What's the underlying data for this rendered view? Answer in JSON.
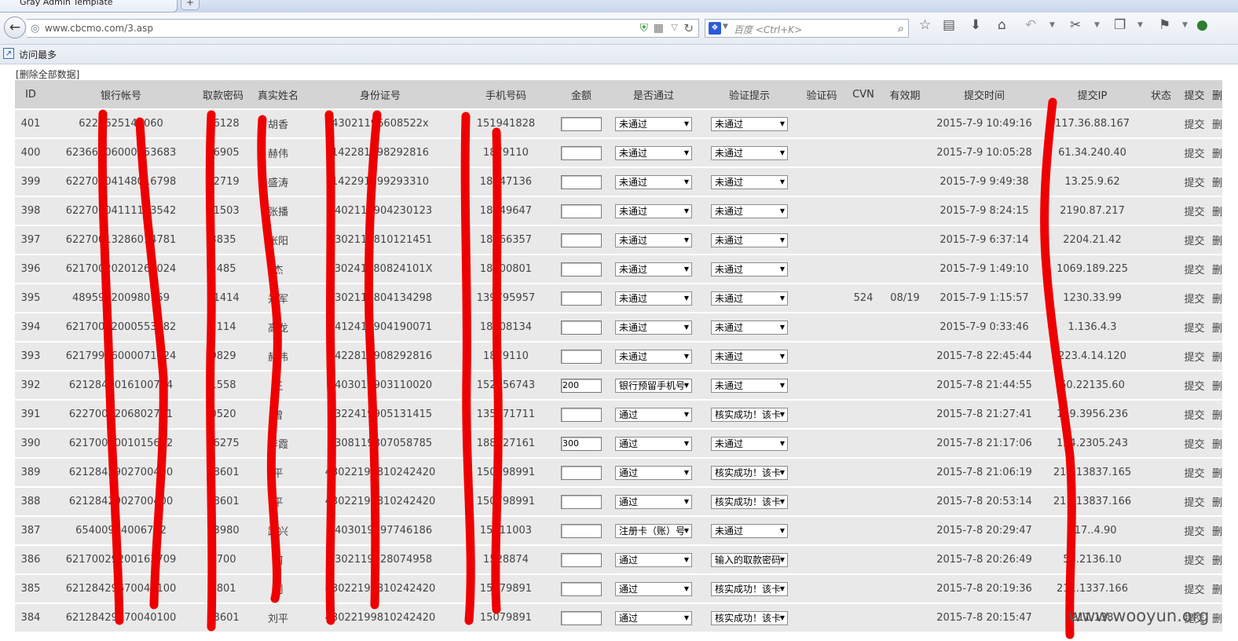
{
  "browser": {
    "tab_title": "Gray Admin Template",
    "new_tab": "+",
    "url": "www.cbcmo.com/3.asp",
    "search_placeholder": "百度 <Ctrl+K>",
    "bookmark_label": "访问最多"
  },
  "page": {
    "clear_all": "[删除全部数据]",
    "watermark": "www.wooyun.org"
  },
  "table": {
    "headers": [
      "ID",
      "银行帐号",
      "取款密码",
      "真实姓名",
      "身份证号",
      "手机号码",
      "金额",
      "是否通过",
      "验证提示",
      "验证码",
      "CVN",
      "有效期",
      "提交时间",
      "提交IP",
      "状态",
      "提交",
      "删除"
    ],
    "submit_label": "提交",
    "delete_label": "删除",
    "rows": [
      {
        "id": "401",
        "account": "62216‌2514‌5060",
        "pwd": "66‌128",
        "name": "胡‌香",
        "idcard": "430‌211966‌08522x",
        "phone": "151‌941828",
        "amount": "",
        "pass": "未通过",
        "hint": "未通过",
        "captcha": "",
        "cvn": "",
        "expiry": "",
        "time": "2015-7-9 10:49:16",
        "ip": "117.‌36.88.167"
      },
      {
        "id": "400",
        "account": "6236680‌60001‌53683",
        "pwd": "96‌905",
        "name": "赫‌伟",
        "idcard": "142‌28199‌8292816",
        "phone": "187‌911‌0",
        "amount": "",
        "pass": "未通过",
        "hint": "未通过",
        "captcha": "",
        "cvn": "",
        "expiry": "",
        "time": "2015-7-9 10:05:28",
        "ip": "61.‌34.240.40"
      },
      {
        "id": "399",
        "account": "62270004‌1480‌16798",
        "pwd": "92‌719",
        "name": "盛‌涛",
        "idcard": "142‌29199‌9293310",
        "phone": "183‌4713‌6",
        "amount": "",
        "pass": "未通过",
        "hint": "未通过",
        "captcha": "",
        "cvn": "",
        "expiry": "",
        "time": "2015-7-9 9:49:38",
        "ip": "1‌3.25.9.62"
      },
      {
        "id": "398",
        "account": "62270004‌1111‌13542",
        "pwd": "21‌503",
        "name": "张‌播",
        "idcard": "140‌21199‌04230123",
        "phone": "188‌4964‌7",
        "amount": "",
        "pass": "未通过",
        "hint": "未通过",
        "captcha": "",
        "cvn": "",
        "expiry": "",
        "time": "2015-7-9 8:24:15",
        "ip": "21‌90.87.217"
      },
      {
        "id": "397",
        "account": "62270013‌2860‌14781",
        "pwd": "38‌35",
        "name": "张‌阳",
        "idcard": "430‌21198‌10121451",
        "phone": "183‌6635‌7",
        "amount": "",
        "pass": "未通过",
        "hint": "未通过",
        "captcha": "",
        "cvn": "",
        "expiry": "",
        "time": "2015-7-9 6:37:14",
        "ip": "22‌04.21.42"
      },
      {
        "id": "396",
        "account": "62170020‌2012‌6‌2024",
        "pwd": "24‌85",
        "name": "‌杰",
        "idcard": "430‌24198‌0824101X",
        "phone": "187‌0080‌1",
        "amount": "",
        "pass": "未通过",
        "hint": "未通过",
        "captcha": "",
        "cvn": "",
        "expiry": "",
        "time": "2015-7-9 1:49:10",
        "ip": "106‌9.189.225"
      },
      {
        "id": "395",
        "account": "489592‌2009801‌59",
        "pwd": "11‌414",
        "name": "郑‌军",
        "idcard": "430‌21198‌04134298",
        "phone": "1397‌9595‌7",
        "amount": "",
        "pass": "未通过",
        "hint": "未通过",
        "captcha": "",
        "cvn": "524",
        "expiry": "08/19",
        "time": "2015-7-9 1:15:57",
        "ip": "12‌30.33.99"
      },
      {
        "id": "394",
        "account": "62170012‌00055‌3182",
        "pwd": "21‌14",
        "name": "高‌龙",
        "idcard": "141‌24199‌04190071",
        "phone": "183‌0813‌4",
        "amount": "",
        "pass": "未通过",
        "hint": "未通过",
        "captcha": "",
        "cvn": "",
        "expiry": "",
        "time": "2015-7-9 0:33:46",
        "ip": "1‌.136.4.3"
      },
      {
        "id": "393",
        "account": "62179916‌00007‌1424",
        "pwd": "98‌29",
        "name": "赫‌伟",
        "idcard": "142‌28199‌08292816",
        "phone": "187‌911‌0",
        "amount": "",
        "pass": "未通过",
        "hint": "未通过",
        "captcha": "",
        "cvn": "",
        "expiry": "",
        "time": "2015-7-8 22:45:44",
        "ip": "223.‌4.14.120"
      },
      {
        "id": "392",
        "account": "62128400‌1610073‌4",
        "pwd": "15‌58",
        "name": "王‌",
        "idcard": "140‌30199‌03110020",
        "phone": "1523‌5674‌3",
        "amount": "200",
        "pass": "银行预留手机号",
        "hint": "未通过",
        "captcha": "",
        "cvn": "",
        "expiry": "",
        "time": "2015-7-8 21:44:55",
        "ip": "60.22‌135.60"
      },
      {
        "id": "391",
        "account": "62270032‌0680278‌1",
        "pwd": "05‌20",
        "name": "曾‌",
        "idcard": "432‌24199‌05131415",
        "phone": "1354‌7171‌1",
        "amount": "",
        "pass": "通过",
        "hint": "核实成功！该卡",
        "captcha": "",
        "cvn": "",
        "expiry": "",
        "time": "2015-7-8 21:27:41",
        "ip": "119.39‌56.236"
      },
      {
        "id": "390",
        "account": "62170030‌0101560‌2",
        "pwd": "66‌275",
        "name": "李‌霞",
        "idcard": "430‌81198‌07058785",
        "phone": "1889‌2716‌1",
        "amount": "300",
        "pass": "通过",
        "hint": "未通过",
        "captcha": "",
        "cvn": "",
        "expiry": "",
        "time": "2015-7-8 21:17:06",
        "ip": "124.230‌5.243"
      },
      {
        "id": "389",
        "account": "62128429‌0270040‌0",
        "pwd": "38‌601",
        "name": "‌平",
        "idcard": "430‌22199‌810242420",
        "phone": "1507‌9899‌1",
        "amount": "",
        "pass": "通过",
        "hint": "核实成功！该卡",
        "captcha": "",
        "cvn": "",
        "expiry": "",
        "time": "2015-7-8 21:06:19",
        "ip": "211.138‌37.165"
      },
      {
        "id": "388",
        "account": "62128429‌0270040‌0",
        "pwd": "38‌601",
        "name": "‌平",
        "idcard": "430‌22199‌810242420",
        "phone": "1507‌9899‌1",
        "amount": "",
        "pass": "通过",
        "hint": "核实成功！该卡",
        "captcha": "",
        "cvn": "",
        "expiry": "",
        "time": "2015-7-8 20:53:14",
        "ip": "211.138‌37.166"
      },
      {
        "id": "387",
        "account": "65400974‌00676‌2",
        "pwd": "139‌80",
        "name": "路‌兴",
        "idcard": "140‌30197‌97746186",
        "phone": "157‌1100‌3",
        "amount": "",
        "pass": "注册卡（账）号",
        "hint": "未通过",
        "captcha": "",
        "cvn": "",
        "expiry": "",
        "time": "2015-7-8 20:29:47",
        "ip": "117.‌.4.90"
      },
      {
        "id": "386",
        "account": "62170029‌2001637‌09",
        "pwd": "770‌0",
        "name": "何‌",
        "idcard": "430‌211992‌8074958",
        "phone": "152‌887‌4",
        "amount": "",
        "pass": "通过",
        "hint": "输入的取款密码",
        "captcha": "",
        "cvn": "",
        "expiry": "",
        "time": "2015-7-8 20:26:49",
        "ip": "58.21‌36.10"
      },
      {
        "id": "385",
        "account": "62128429‌6‌70040100",
        "pwd": "38‌01",
        "name": "刘‌",
        "idcard": "430‌22199‌810242420",
        "phone": "1507‌989‌1",
        "amount": "",
        "pass": "通过",
        "hint": "核实成功！该卡",
        "captcha": "",
        "cvn": "",
        "expiry": "",
        "time": "2015-7-8 20:19:36",
        "ip": "211.13‌37.166"
      },
      {
        "id": "384",
        "account": "62128429‌6‌70040100",
        "pwd": "38‌601",
        "name": "刘平",
        "idcard": "430‌22199810242420",
        "phone": "1507‌989‌1",
        "amount": "",
        "pass": "通过",
        "hint": "核实成功！该卡",
        "captcha": "",
        "cvn": "",
        "expiry": "",
        "time": "2015-7-8 20:15:47",
        "ip": "211.138‌"
      }
    ]
  }
}
